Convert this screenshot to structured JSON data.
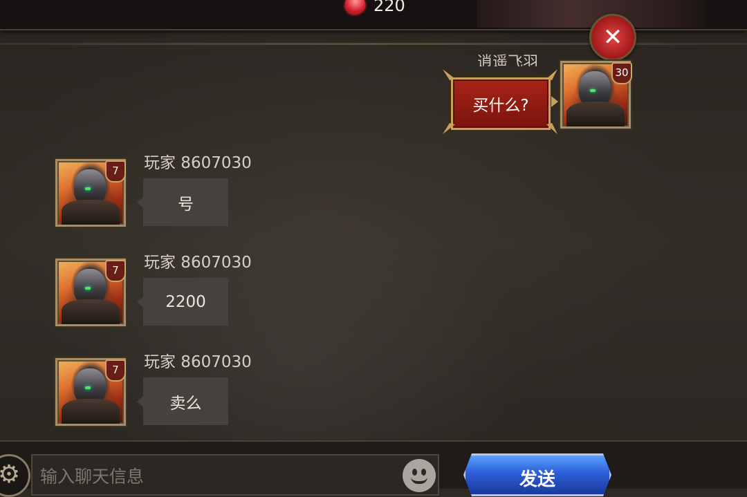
{
  "currency": {
    "amount": "220",
    "icon": "red-gem-icon"
  },
  "close_icon": "close-icon",
  "self_message": {
    "sender_name": "逍遥飞羽",
    "level": "30",
    "text": "买什么?"
  },
  "messages": [
    {
      "sender": "玩家 8607030",
      "level": "7",
      "text": "号"
    },
    {
      "sender": "玩家 8607030",
      "level": "7",
      "text": "2200"
    },
    {
      "sender": "玩家 8607030",
      "level": "7",
      "text": "卖么"
    }
  ],
  "input": {
    "placeholder": "输入聊天信息",
    "value": ""
  },
  "send_label": "发送",
  "icons": {
    "settings": "gear-icon",
    "emoji": "emoji-icon"
  },
  "colors": {
    "accent_red": "#a82418",
    "send_blue": "#2c5ed8",
    "frame_gold": "#a89064"
  }
}
